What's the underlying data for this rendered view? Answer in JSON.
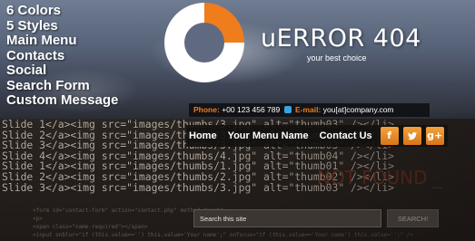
{
  "features": [
    "6 Colors",
    "5 Styles",
    "Main Menu",
    "Contacts",
    "Social",
    "Search Form",
    "Custom Message"
  ],
  "brand": {
    "name": "uERROR 404",
    "tagline": "your best choice"
  },
  "contact": {
    "phone_label": "Phone:",
    "phone_value": "+00 123 456 789",
    "email_label": "E-mail:",
    "email_value": "you[at]company.com"
  },
  "nav": {
    "items": [
      "Home",
      "Your Menu Name",
      "Contact Us"
    ]
  },
  "social": [
    {
      "name": "facebook-icon",
      "glyph": "f"
    },
    {
      "name": "twitter-icon",
      "glyph": ""
    },
    {
      "name": "google-plus-icon",
      "glyph": "g+"
    }
  ],
  "background_code": [
    "Slide 1</a><img src=\"images/thumbs/3.jpg\" alt=\"thumb03\" /></li>",
    "Slide 2</a><img src=\"images/thumbs/3.jpg\" alt=\"thumb03\" /></li>",
    "Slide 3</a><img src=\"images/thumbs/3.jpg\" alt=\"thumb03\" /></li>",
    "Slide 4</a><img src=\"images/thumbs/4.jpg\" alt=\"thumb04\" /></li>",
    "Slide 1</a><img src=\"images/thumbs/1.jpg\" alt=\"thumb01\" /></li>",
    "Slide 2</a><img src=\"images/thumbs/2.jpg\" alt=\"thumb02\" /></li>",
    "Slide 3</a><img src=\"images/thumbs/3.jpg\" alt=\"thumb03\" /></li>"
  ],
  "background_code_small": [
    "<form id=\"contact-form\" action=\"contact.php\" method=\"post\">",
    "<p>",
    "<span class=\"name-required\"></span>",
    "<input onblur=\"if (this.value=='') this.value='Your name';\" onfocus=\"if (this.value=='Your name') this.value='';\" />"
  ],
  "ghost_message": {
    "main": "NOT FOUND",
    "tail": "_"
  },
  "search": {
    "placeholder": "Search this site",
    "button_label": "SEARCH!"
  },
  "colors": {
    "accent": "#ef7d1b",
    "logo_white": "#ffffff",
    "contact_bar": "#0a0a0c",
    "code_text": "#b7aea4"
  }
}
